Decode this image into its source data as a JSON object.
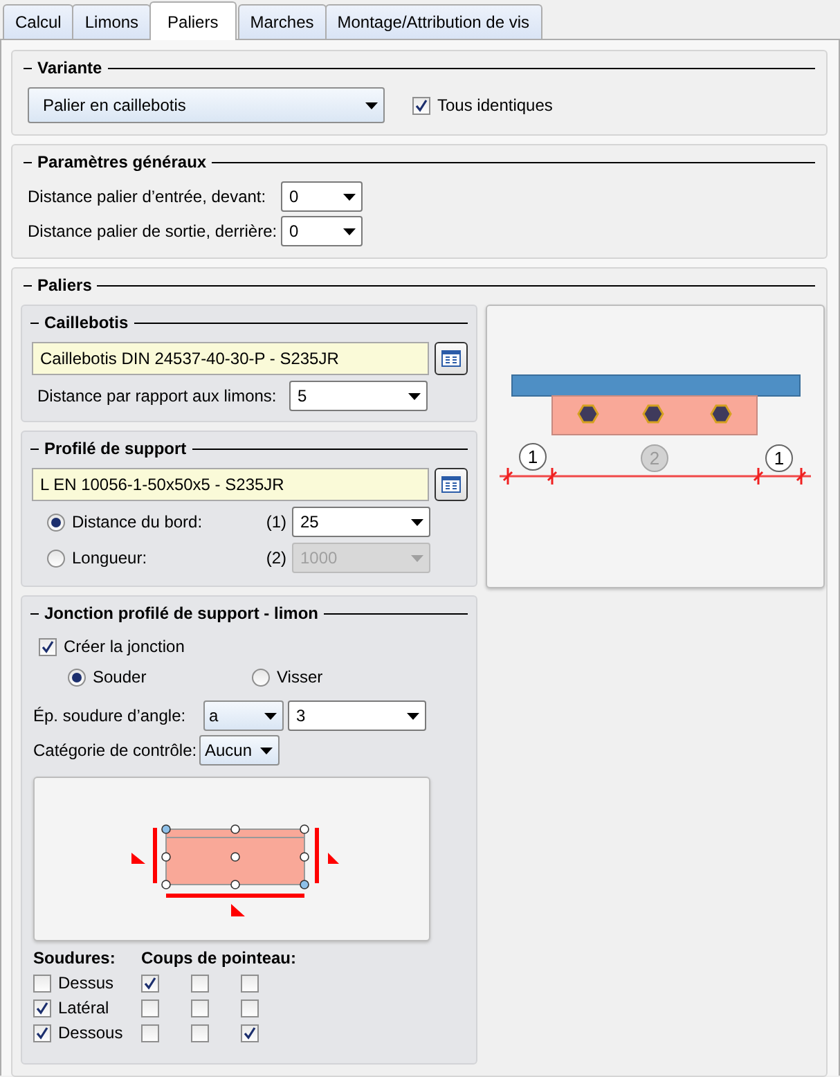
{
  "tabs": [
    {
      "label": "Calcul",
      "selected": false
    },
    {
      "label": "Limons",
      "selected": false
    },
    {
      "label": "Paliers",
      "selected": true
    },
    {
      "label": "Marches",
      "selected": false
    },
    {
      "label": "Montage/Attribution de vis",
      "selected": false
    }
  ],
  "variante": {
    "title": "Variante",
    "type": "Palier en caillebotis",
    "all_identical": {
      "label": "Tous identiques",
      "checked": true
    }
  },
  "parametres": {
    "title": "Paramètres généraux",
    "rows": [
      {
        "label": "Distance palier d’entrée, devant:",
        "value": "0"
      },
      {
        "label": "Distance palier de sortie, derrière:",
        "value": "0"
      }
    ]
  },
  "paliers": {
    "title": "Paliers",
    "caillebotis": {
      "title": "Caillebotis",
      "material": "Caillebotis DIN 24537-40-30-P - S235JR",
      "distance_label": "Distance par rapport aux limons:",
      "distance_value": "5"
    },
    "profile": {
      "title": "Profilé de support",
      "material": "L EN 10056-1-50x50x5 - S235JR",
      "options": [
        {
          "label": "Distance du bord:",
          "index": "(1)",
          "value": "25",
          "selected": true,
          "disabled": false
        },
        {
          "label": "Longueur:",
          "index": "(2)",
          "value": "1000",
          "selected": false,
          "disabled": true
        }
      ]
    },
    "section_diagram": {
      "callouts": [
        {
          "label": "1",
          "active": true
        },
        {
          "label": "2",
          "active": false
        },
        {
          "label": "1",
          "active": true
        }
      ]
    },
    "jonction": {
      "title": "Jonction profilé de support - limon",
      "create": {
        "label": "Créer la jonction",
        "checked": true
      },
      "methods": [
        {
          "label": "Souder",
          "selected": true
        },
        {
          "label": "Visser",
          "selected": false
        }
      ],
      "weld_thickness": {
        "label": "Ép. soudure d’angle:",
        "type": "a",
        "value": "3"
      },
      "control_category": {
        "label": "Catégorie de contrôle:",
        "value": "Aucun"
      },
      "welds_heading": "Soudures:",
      "punch_heading": "Coups de pointeau:",
      "rows": [
        {
          "label": "Dessus",
          "checked": false,
          "punches": [
            {
              "checked": true
            },
            {
              "checked": false
            },
            {
              "checked": false
            }
          ]
        },
        {
          "label": "Latéral",
          "checked": true,
          "punches": [
            {
              "checked": false
            },
            {
              "checked": false
            },
            {
              "checked": false
            }
          ]
        },
        {
          "label": "Dessous",
          "checked": true,
          "punches": [
            {
              "checked": false
            },
            {
              "checked": false
            },
            {
              "checked": true
            }
          ]
        }
      ]
    }
  }
}
